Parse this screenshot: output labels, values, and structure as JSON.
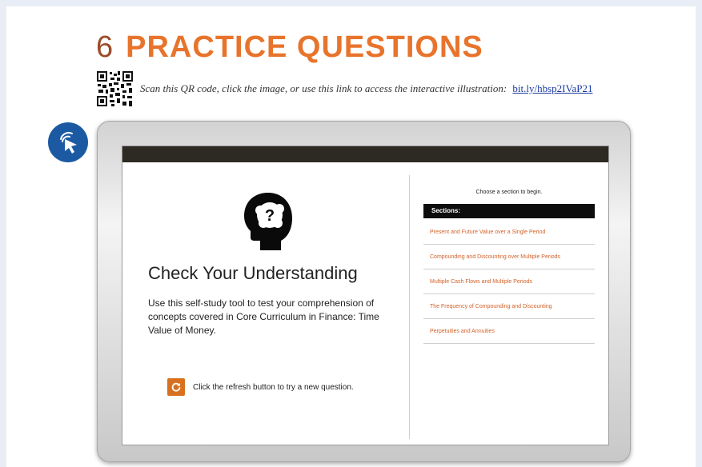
{
  "header": {
    "number": "6",
    "title": "PRACTICE QUESTIONS"
  },
  "qr": {
    "text": "Scan this QR code, click the image, or use this link to access the interactive illustration:",
    "link": "bit.ly/hbsp2IVaP21"
  },
  "screen": {
    "title": "Check Your Understanding",
    "description": "Use this self-study tool to test your comprehension of concepts covered in Core Curriculum in Finance: Time Value of Money.",
    "refresh_text": "Click the refresh button to try a new question.",
    "choose_text": "Choose a section to begin.",
    "sections_label": "Sections:",
    "sections": [
      {
        "label": "Present and Future Value over a Single Period"
      },
      {
        "label": "Compounding and Discounting over Multiple Periods"
      },
      {
        "label": "Multiple Cash Flows and Multiple Periods"
      },
      {
        "label": "The Frequency of Compounding and Discounting"
      },
      {
        "label": "Perpetuities and Annuities"
      }
    ]
  },
  "colors": {
    "accent_orange": "#e8742c",
    "section_link": "#d2622a",
    "badge_blue": "#1b5aa2"
  },
  "icons": [
    "qr-code-icon",
    "cursor-icon",
    "brain-question-icon",
    "refresh-icon"
  ]
}
